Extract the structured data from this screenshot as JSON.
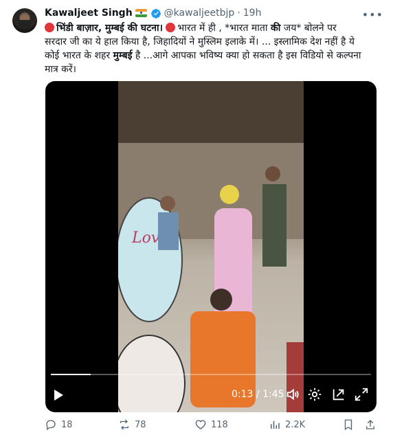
{
  "author": {
    "name": "Kawaljeet Singh",
    "handle": "@kawaljeetbjp",
    "separator": "·",
    "time": "19h"
  },
  "tweet": {
    "line1_a": "भिंडी बाज़ार, मुम्बई  की घटना।",
    "line1_b": "भारत में ही , *भारत माता ",
    "line1_c": "की",
    "line1_d": " जय* बोलने पर",
    "line2": "सरदार जी का ये हाल किया है, जिहादियों ने मुस्लिम इलाके में। ... इस्लामिक देश नहीं है ये",
    "line3_a": "कोई भारत के शहर ",
    "line3_b": "मुम्बई",
    "line3_c": "  है ...आगे आपका भविष्य क्या हो सकता है  इस विडियो से कल्पना",
    "line4": "मात्र करें।"
  },
  "video": {
    "overlay_text": "Love",
    "current_time": "0:13",
    "time_separator": " / ",
    "duration": "1:45",
    "progress": 0.124
  },
  "actions": {
    "replies": "18",
    "reposts": "78",
    "likes": "118",
    "views": "2.2K"
  },
  "colors": {
    "text": "#0f1419",
    "muted": "#536471",
    "verified": "#1d9bf0"
  }
}
